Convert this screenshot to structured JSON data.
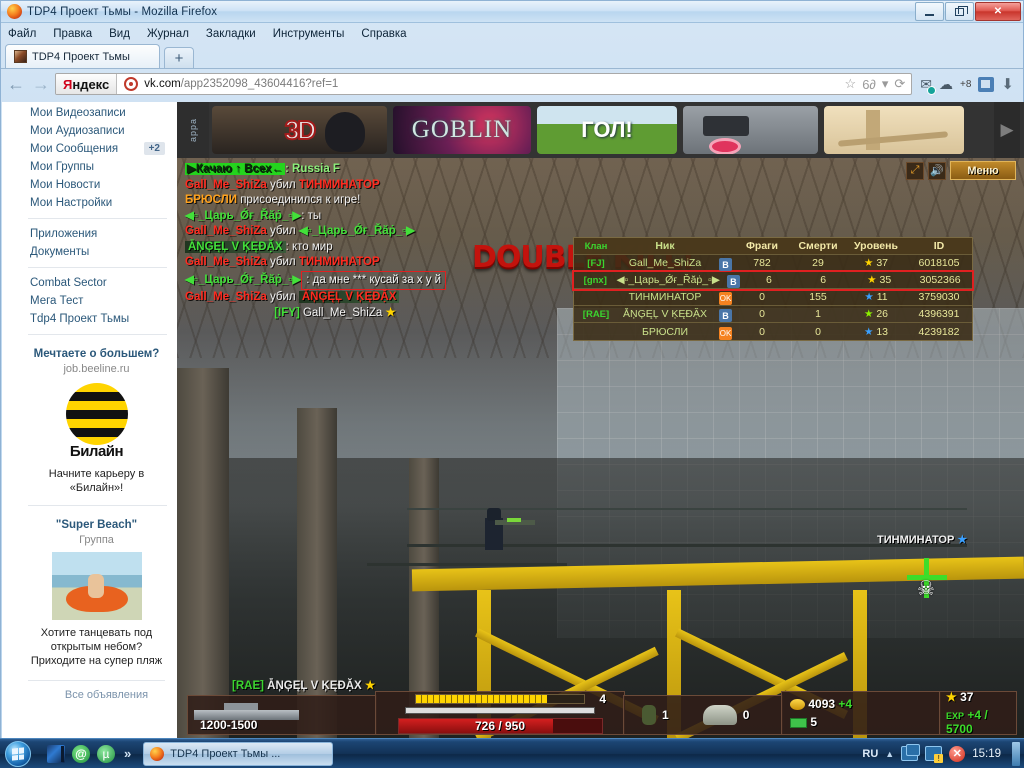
{
  "window": {
    "title": "TDP4 Проект Тьмы - Mozilla Firefox",
    "minimize_label": "Свернуть",
    "restore_label": "Восстановить",
    "close_label": "✕"
  },
  "menubar": [
    "Файл",
    "Правка",
    "Вид",
    "Журнал",
    "Закладки",
    "Инструменты",
    "Справка"
  ],
  "tab": {
    "title": "TDP4 Проект Тьмы",
    "newtab_label": "+"
  },
  "navbar": {
    "back": "←",
    "forward": "→",
    "search_engine_red": "Я",
    "search_engine_rest": "ндекс",
    "url_domain": "vk.com",
    "url_path": "/app2352098_43604416?ref=1",
    "bookmark_star": "☆",
    "glasses": "6∂",
    "dropdown": "▾",
    "reload": "⟳",
    "mail": "✉",
    "weather": "☁",
    "weather_count": "+8",
    "download": "⬇"
  },
  "sidebar": {
    "items": [
      {
        "label": "Мои Видеозаписи",
        "count": ""
      },
      {
        "label": "Мои Аудиозаписи",
        "count": ""
      },
      {
        "label": "Мои Сообщения",
        "count": "+2"
      },
      {
        "label": "Мои Группы",
        "count": ""
      },
      {
        "label": "Мои Новости",
        "count": ""
      },
      {
        "label": "Мои Настройки",
        "count": ""
      }
    ],
    "group2": [
      {
        "label": "Приложения"
      },
      {
        "label": "Документы"
      }
    ],
    "group3": [
      {
        "label": "Combat Sector"
      },
      {
        "label": "Мега Тест"
      },
      {
        "label": "Tdp4 Проект Тьмы"
      }
    ],
    "ads": [
      {
        "title": "Мечтаете о большем?",
        "sub": "job.beeline.ru",
        "logo_word": "Билайн",
        "text": "Начните карьеру в «Билайн»!"
      },
      {
        "title": "\"Super Beach\"",
        "sub": "Группа",
        "text": "Хотите танцевать под открытым небом? Приходите на супер пляж"
      }
    ],
    "all_ads": "Все объявления"
  },
  "game": {
    "banner": {
      "side_label": "appa",
      "items": [
        "3D",
        "GOBLIN",
        "ГОЛ!",
        "",
        ""
      ],
      "arrow": "▶"
    },
    "tools": {
      "fullscreen": "⤢",
      "sound": "🔊",
      "menu_label": "Меню"
    },
    "server_line": {
      "tag": "▶Качаю ↑ Всех←",
      "name": ": Russia F"
    },
    "chat": [
      {
        "actor": "Gall_Me_ShiZa",
        "verb": "убил",
        "target": "ТИНМИНАТОР"
      },
      {
        "actor": "БРЮСЛИ",
        "verb": "присоединился к игре!",
        "target": ""
      },
      {
        "actor": "◀▫_Царь_Ǿғ_Řăṗ_▫▶",
        "verb": ":",
        "target": "ты"
      },
      {
        "actor": "Gall_Me_ShiZa",
        "verb": "убил",
        "target": "◀▫_Царь_Ǿғ_Řăṗ_▫▶"
      },
      {
        "actor": "ẴŅĢĘĻ V ĶĘĐẶX",
        "verb": ":",
        "target": "кто мир"
      },
      {
        "actor": "Gall_Me_ShiZa",
        "verb": "убил",
        "target": "ТИНМИНАТОР"
      },
      {
        "actor": "◀▫_Царь_Ǿғ_Řăṗ_▫▶",
        "verb": ":",
        "target": "да мне *** кусай за х у й"
      },
      {
        "actor": "Gall_Me_ShiZa",
        "verb": "убил",
        "target": "ẴŅĢĘĻ V ĶĘĐẶX"
      },
      {
        "actor": "[IFY]",
        "verb": "Gall_Me_ShiZa",
        "target": "★"
      }
    ],
    "killstreak": "DOUBLE KILL!",
    "scoreboard": {
      "headers": [
        "Клан",
        "Ник",
        "Фраги",
        "Смерти",
        "Уровень",
        "ID"
      ],
      "rows": [
        {
          "clan": "[FJ]",
          "nick": "Gall_Me_ShiZa",
          "badge": "B",
          "frags": "782",
          "deaths": "29",
          "level": "37",
          "star": "yellow",
          "id": "6018105",
          "highlight": false
        },
        {
          "clan": "[gnx]",
          "nick": "◀▫_Царь_Ǿғ_Řăṗ_▫▶",
          "badge": "B",
          "frags": "6",
          "deaths": "6",
          "level": "35",
          "star": "yellow",
          "id": "3052366",
          "highlight": true
        },
        {
          "clan": "",
          "nick": "ТИНМИНАТОР",
          "badge": "OK",
          "frags": "0",
          "deaths": "155",
          "level": "11",
          "star": "blue",
          "id": "3759030",
          "highlight": false
        },
        {
          "clan": "[RAE]",
          "nick": "ẴŅĢĘĻ V ĶĘĐẶX",
          "badge": "B",
          "frags": "0",
          "deaths": "1",
          "level": "26",
          "star": "green",
          "id": "4396391",
          "highlight": false
        },
        {
          "clan": "",
          "nick": "БРЮСЛИ",
          "badge": "OK",
          "frags": "0",
          "deaths": "0",
          "level": "13",
          "star": "blue",
          "id": "4239182",
          "highlight": false
        }
      ]
    },
    "enemy_label": "ТИНМИНАТОР",
    "enemy_star": "★",
    "hud": {
      "player_clan": "[RAE]",
      "player_name": "ẴŅĢĘĻ V ĶĘĐẶX",
      "player_star": "★",
      "weapon_damage": "1200-1500",
      "ammo": "4",
      "health": "726 / 950",
      "grenades": "1",
      "mines": "0",
      "gold": "4093",
      "gold_gain": "+4",
      "money": "5",
      "level": "37",
      "exp_label": "EXP",
      "exp": "+4 / 5700"
    }
  },
  "taskbar": {
    "start_label": "Пуск",
    "quicklaunch": [
      "media-player",
      "browser-at",
      "utorrent"
    ],
    "more": "»",
    "task": "TDP4 Проект Тьмы ...",
    "tray": {
      "lang": "RU",
      "up": "▲",
      "clock": "15:19"
    }
  }
}
